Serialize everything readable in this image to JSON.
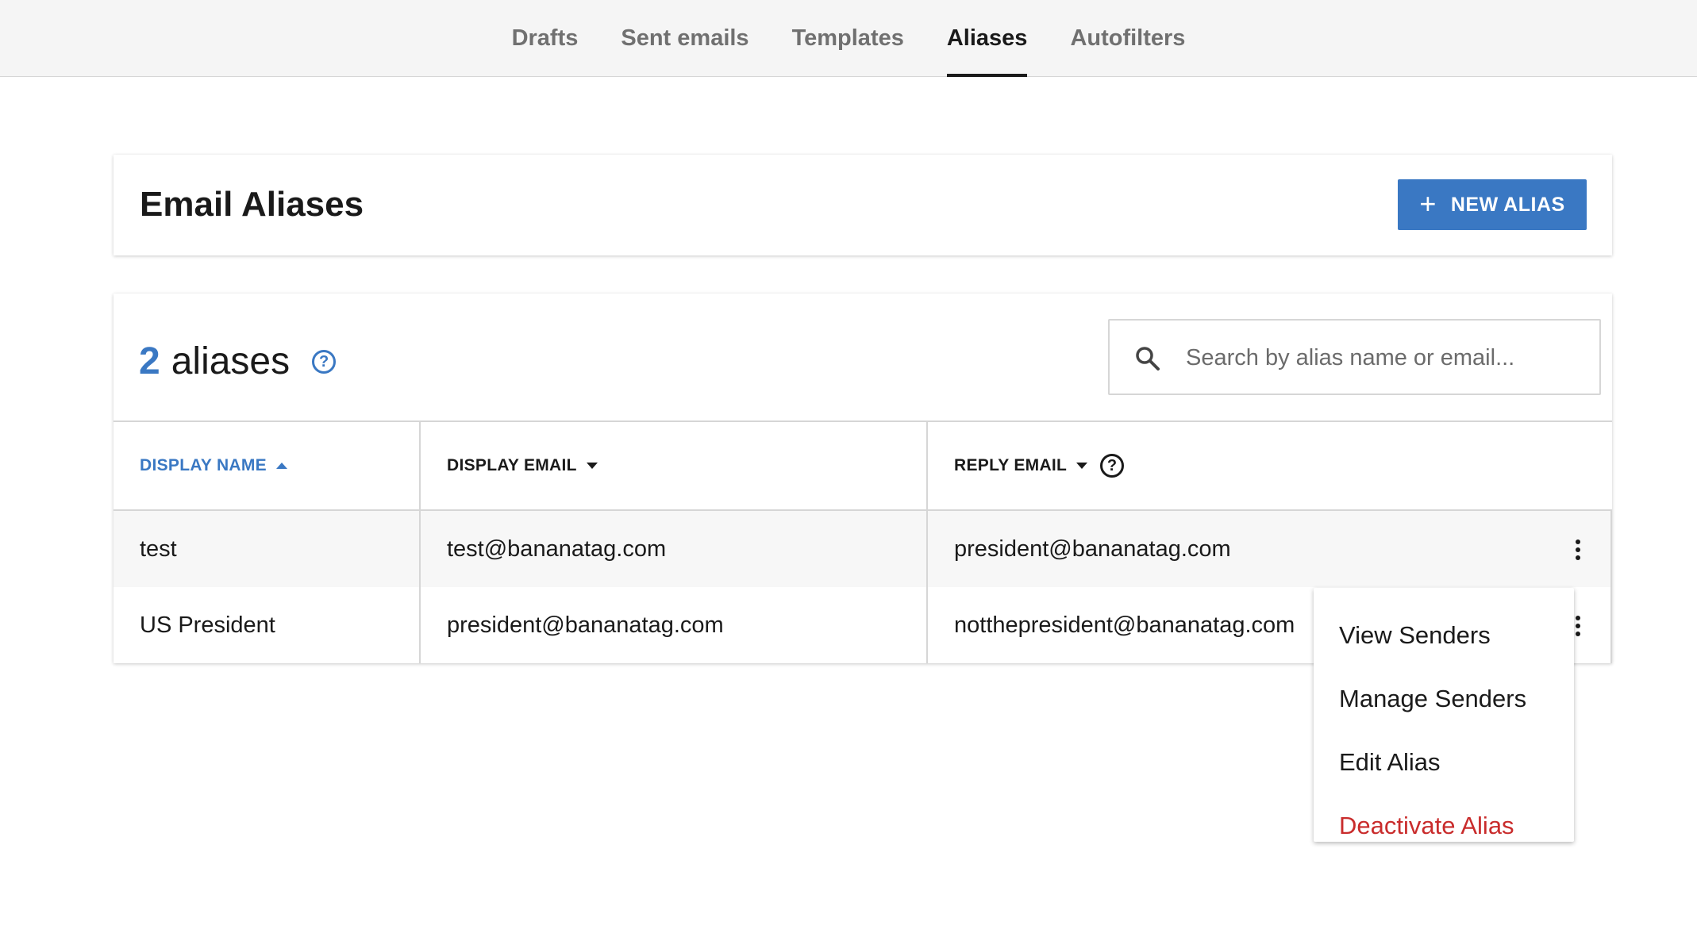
{
  "nav": {
    "tabs": [
      {
        "label": "Drafts",
        "active": false
      },
      {
        "label": "Sent emails",
        "active": false
      },
      {
        "label": "Templates",
        "active": false
      },
      {
        "label": "Aliases",
        "active": true
      },
      {
        "label": "Autofilters",
        "active": false
      }
    ]
  },
  "header": {
    "title": "Email Aliases",
    "new_button_label": "NEW ALIAS",
    "new_button_icon": "plus-icon"
  },
  "summary": {
    "count": "2",
    "count_label": "aliases",
    "help_icon": "question-circle-icon"
  },
  "search": {
    "placeholder": "Search by alias name or email...",
    "value": "",
    "icon": "search-icon"
  },
  "table": {
    "columns": [
      {
        "label": "DISPLAY NAME",
        "sort": "ascending",
        "active": true
      },
      {
        "label": "DISPLAY EMAIL",
        "sort": "descending",
        "active": false
      },
      {
        "label": "REPLY EMAIL",
        "sort": "descending",
        "active": false,
        "help": true
      }
    ],
    "rows": [
      {
        "display_name": "test",
        "display_email": "test@bananatag.com",
        "reply_email": "president@bananatag.com"
      },
      {
        "display_name": "US President",
        "display_email": "president@bananatag.com",
        "reply_email": "notthepresident@bananatag.com"
      }
    ]
  },
  "row_menu": {
    "items": [
      {
        "label": "View Senders"
      },
      {
        "label": "Manage Senders"
      },
      {
        "label": "Edit Alias"
      },
      {
        "label": "Deactivate Alias",
        "danger": true
      }
    ]
  },
  "colors": {
    "accent": "#3a78c3",
    "danger": "#c92c2c",
    "nav_bg": "#f5f5f5"
  }
}
